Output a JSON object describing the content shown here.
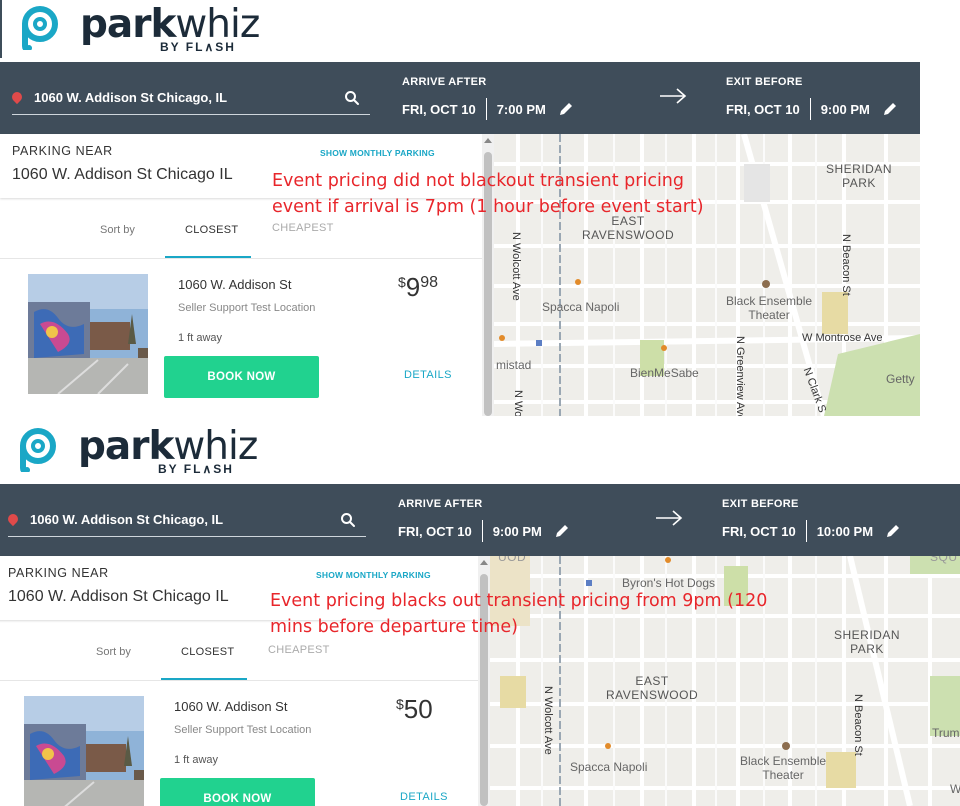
{
  "brand": {
    "name_bold": "park",
    "name_light": "whiz",
    "byline": "BY FL∧SH"
  },
  "colors": {
    "nav_bg": "#3f4d5a",
    "accent": "#1aa7c6",
    "book_button": "#21d28f",
    "annotation": "#e8262b",
    "pin": "#e04a4a"
  },
  "panels": [
    {
      "search": {
        "location": "1060 W. Addison St Chicago, IL",
        "icon": "search-icon"
      },
      "arrive": {
        "label": "ARRIVE AFTER",
        "date": "FRI, OCT 10",
        "time": "7:00 PM"
      },
      "exit": {
        "label": "EXIT BEFORE",
        "date": "FRI, OCT 10",
        "time": "9:00 PM"
      },
      "sidebar": {
        "parking_near_label": "PARKING NEAR",
        "parking_near_address": "1060 W. Addison St Chicago IL",
        "monthly_link": "SHOW MONTHLY PARKING",
        "sort_by": "Sort by",
        "tabs": [
          "CLOSEST",
          "CHEAPEST"
        ],
        "listing": {
          "name": "1060 W. Addison St",
          "subtitle": "Seller Support Test Location",
          "distance": "1 ft away",
          "price_currency": "$",
          "price_dollars": "9",
          "price_cents": "98",
          "book_label": "BOOK NOW",
          "details_label": "DETAILS"
        }
      },
      "map_labels": {
        "sheridan_park": "SHERIDAN\nPARK",
        "east_ravenswood": "EAST\nRAVENSWOOD",
        "spacca_napoli": "Spacca Napoli",
        "black_ensemble": "Black Ensemble\nTheater",
        "montrose": "W Montrose Ave",
        "bienmesabe": "BienMeSabe",
        "amistad": "mistad",
        "getty": "Getty",
        "wolcott": "N Wolcott Ave",
        "wolcott_b": "N Wo",
        "beacon": "N Beacon St",
        "greenview": "N Greenview Ave",
        "clark": "N Clark S"
      },
      "annotation": [
        "Event pricing did not blackout transient pricing",
        "event if arrival is 7pm (1 hour before event start)"
      ]
    },
    {
      "search": {
        "location": "1060 W. Addison St Chicago, IL",
        "icon": "search-icon"
      },
      "arrive": {
        "label": "ARRIVE AFTER",
        "date": "FRI, OCT 10",
        "time": "9:00 PM"
      },
      "exit": {
        "label": "EXIT BEFORE",
        "date": "FRI, OCT 10",
        "time": "10:00 PM"
      },
      "sidebar": {
        "parking_near_label": "PARKING NEAR",
        "parking_near_address": "1060 W. Addison St Chicago IL",
        "monthly_link": "SHOW MONTHLY PARKING",
        "sort_by": "Sort by",
        "tabs": [
          "CLOSEST",
          "CHEAPEST"
        ],
        "listing": {
          "name": "1060 W. Addison St",
          "subtitle": "Seller Support Test Location",
          "distance": "1 ft away",
          "price_currency": "$",
          "price_dollars": "50",
          "price_cents": "",
          "book_label": "BOOK NOW",
          "details_label": "DETAILS"
        }
      },
      "map_labels": {
        "sheridan_park": "SHERIDAN\nPARK",
        "east_ravenswood": "EAST\nRAVENSWOOD",
        "spacca_napoli": "Spacca Napoli",
        "black_ensemble": "Black Ensemble\nTheater",
        "byrons": "Byron's Hot Dogs",
        "wolcott": "N Wolcott Ave",
        "beacon": "N Beacon St",
        "trum": "Trum",
        "squ": "SQU",
        "uod": "UOD",
        "w": "W"
      },
      "annotation": [
        "Event pricing blacks out transient pricing from 9pm (120",
        "mins before departure time)"
      ]
    }
  ]
}
